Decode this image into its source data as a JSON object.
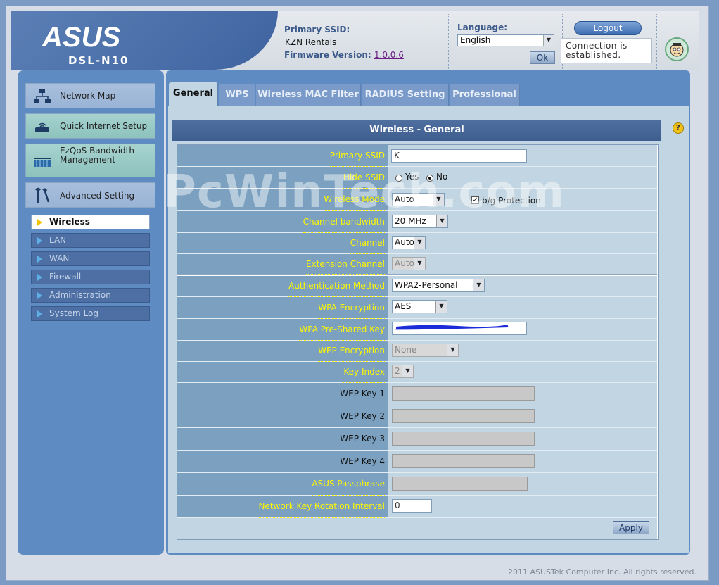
{
  "header": {
    "logo_text": "ASUS",
    "model": "DSL-N10",
    "ssid_label": "Primary SSID:",
    "ssid_value": "KZN Rentals",
    "firmware_label": "Firmware Version:",
    "firmware_value": "1.0.0.6",
    "language_label": "Language:",
    "language_value": "English",
    "ok_label": "Ok",
    "logout_label": "Logout",
    "status_text": "Connection is established."
  },
  "menu": {
    "items": [
      {
        "label": "Network Map",
        "icon": "network-map-icon"
      },
      {
        "label": "Quick Internet Setup",
        "icon": "router-icon"
      },
      {
        "label": "EzQoS Bandwidth Management",
        "icon": "qos-icon"
      },
      {
        "label": "Advanced Setting",
        "icon": "tools-icon"
      }
    ],
    "sub_items": [
      {
        "label": "Wireless",
        "active": true
      },
      {
        "label": "LAN"
      },
      {
        "label": "WAN"
      },
      {
        "label": "Firewall"
      },
      {
        "label": "Administration"
      },
      {
        "label": "System Log"
      }
    ]
  },
  "tabs": [
    "General",
    "WPS",
    "Wireless MAC Filter",
    "RADIUS Setting",
    "Professional"
  ],
  "form": {
    "title": "Wireless - General",
    "primary_ssid_label": "Primary SSID",
    "primary_ssid_value": "K",
    "hide_ssid_label": "Hide SSID",
    "hide_ssid_yes": "Yes",
    "hide_ssid_no": "No",
    "wireless_mode_label": "Wireless Mode",
    "wireless_mode_value": "Auto",
    "bg_protection_label": "b/g Protection",
    "channel_bandwidth_label": "Channel bandwidth",
    "channel_bandwidth_value": "20 MHz",
    "channel_label": "Channel",
    "channel_value": "Auto",
    "extension_channel_label": "Extension Channel",
    "extension_channel_value": "Auto",
    "auth_method_label": "Authentication Method",
    "auth_method_value": "WPA2-Personal",
    "wpa_encryption_label": "WPA Encryption",
    "wpa_encryption_value": "AES",
    "wpa_psk_label": "WPA Pre-Shared Key",
    "wep_encryption_label": "WEP Encryption",
    "wep_encryption_value": "None",
    "key_index_label": "Key Index",
    "key_index_value": "2",
    "wep_key1_label": "WEP Key 1",
    "wep_key2_label": "WEP Key 2",
    "wep_key3_label": "WEP Key 3",
    "wep_key4_label": "WEP Key 4",
    "passphrase_label": "ASUS Passphrase",
    "rotation_label": "Network Key Rotation Interval",
    "rotation_value": "0",
    "apply_label": "Apply"
  },
  "watermark": "PcWinTech.com",
  "footer": "2011 ASUSTek Computer Inc. All rights reserved.",
  "colors": {
    "accent": "#3e63a0",
    "label_text": "#fff800",
    "panel_bg": "#5f8bc3"
  }
}
